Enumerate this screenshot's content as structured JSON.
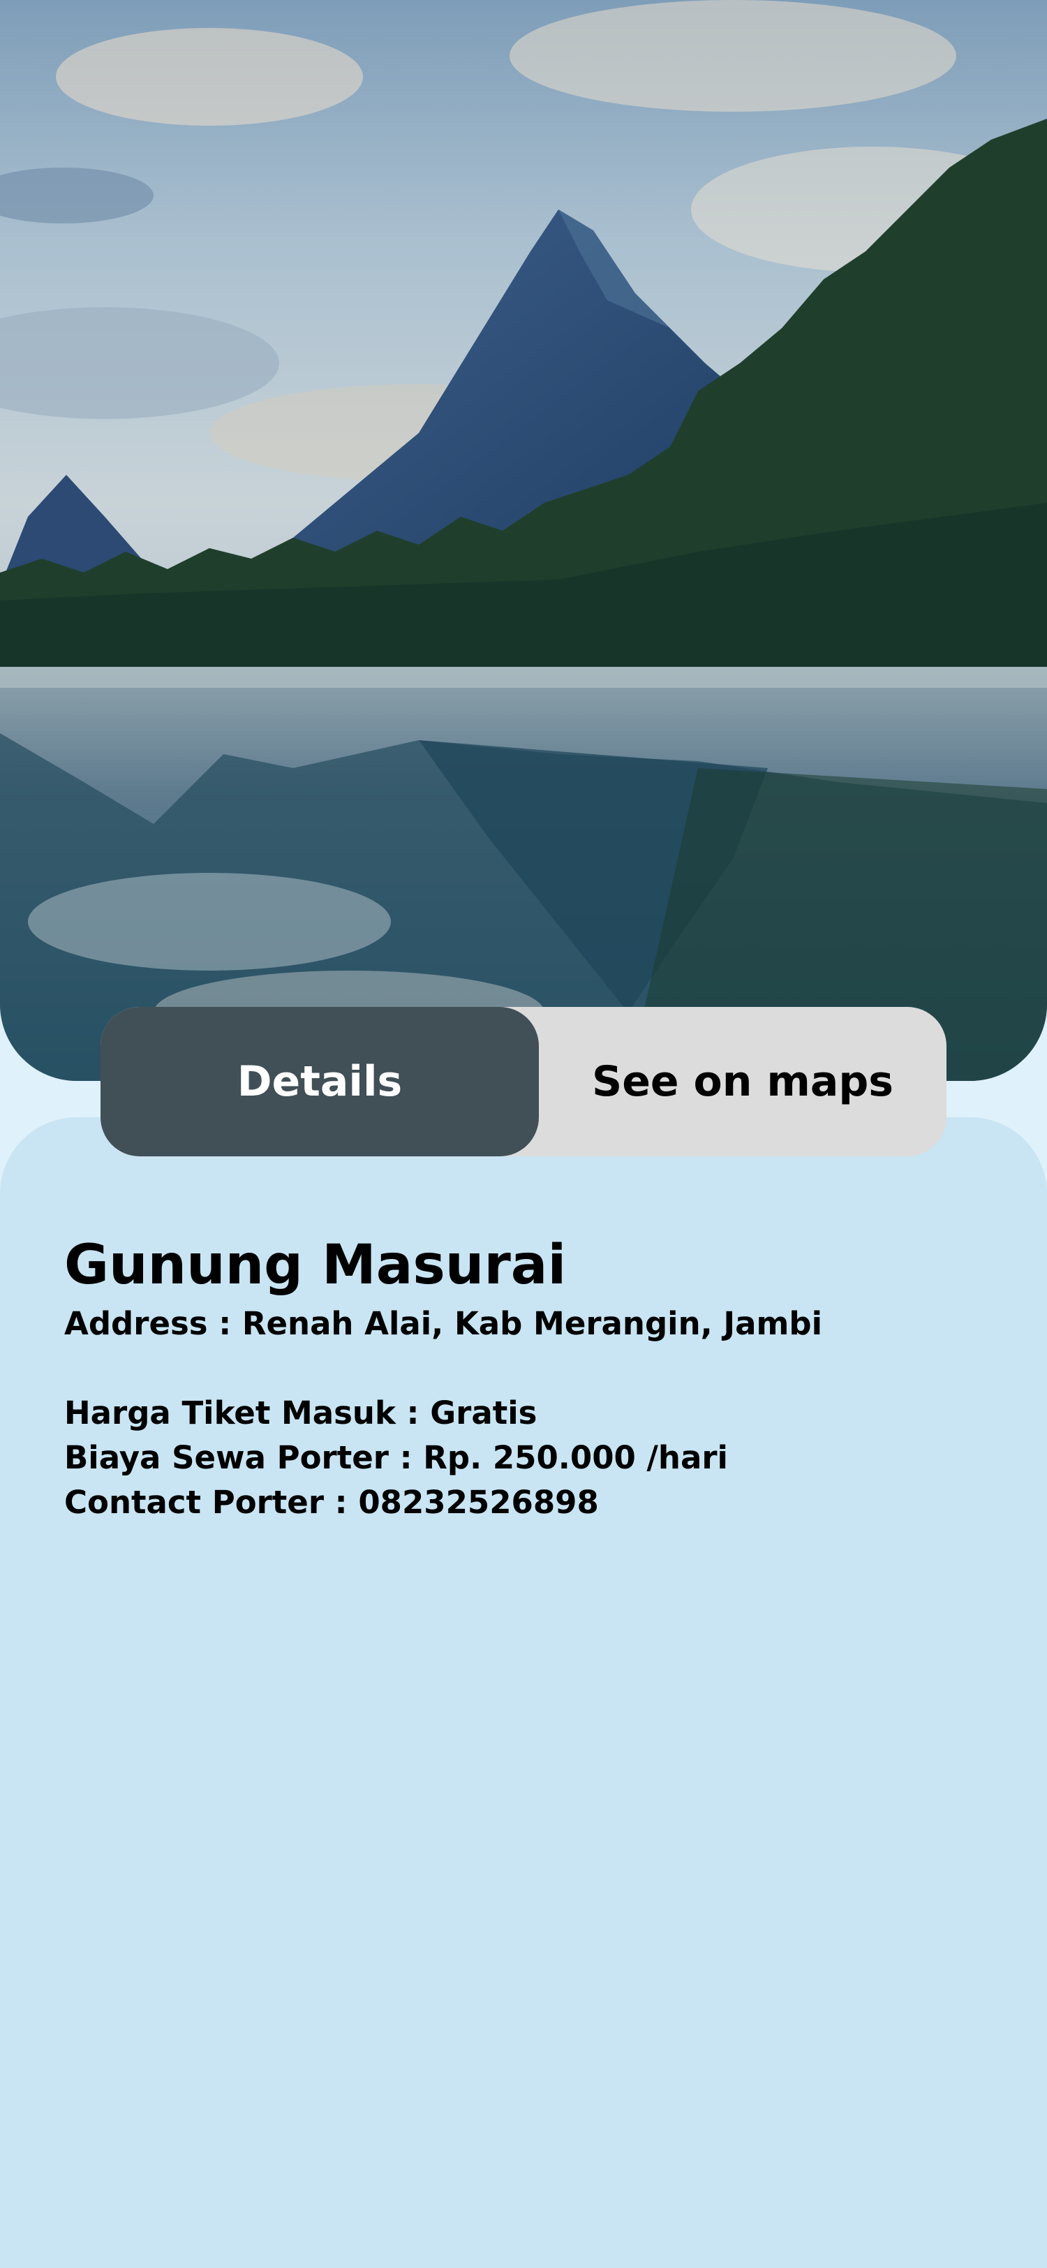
{
  "hero": {
    "image": "mountain-lake-photo"
  },
  "tabs": [
    {
      "label": "Details",
      "active": true
    },
    {
      "label": "See on maps",
      "active": false
    }
  ],
  "place": {
    "name": "Gunung Masurai",
    "address": "Address : Renah Alai, Kab Merangin, Jambi",
    "ticket": "Harga Tiket Masuk : Gratis",
    "porter_fee": "Biaya Sewa Porter : Rp. 250.000 /hari",
    "porter_contact": "Contact Porter : 08232526898"
  },
  "colors": {
    "active_tab": "#414f56",
    "inactive_tab": "#dcdcdc",
    "panel": "#c9e5f3",
    "page_background": "#dff1fa"
  }
}
